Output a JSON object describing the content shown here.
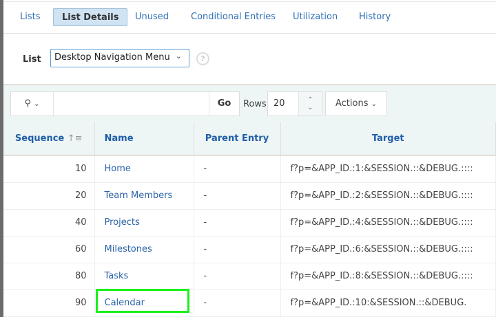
{
  "tabs": [
    {
      "label": "Lists"
    },
    {
      "label": "List Details",
      "active": true
    },
    {
      "label": "Unused"
    },
    {
      "label": "Conditional Entries"
    },
    {
      "label": "Utilization"
    },
    {
      "label": "History"
    }
  ],
  "list_field": {
    "label": "List",
    "value": "Desktop Navigation Menu",
    "help": "?"
  },
  "toolbar": {
    "search_value": "",
    "go_label": "Go",
    "rows_label": "Rows",
    "rows_value": "20",
    "actions_label": "Actions"
  },
  "columns": [
    "Sequence",
    "Name",
    "Parent Entry",
    "Target"
  ],
  "rows": [
    {
      "seq": "10",
      "name": "Home",
      "parent": "-",
      "target": "f?p=&APP_ID.:1:&SESSION.::&DEBUG.::::"
    },
    {
      "seq": "20",
      "name": "Team Members",
      "parent": "-",
      "target": "f?p=&APP_ID.:2:&SESSION.::&DEBUG.::::"
    },
    {
      "seq": "40",
      "name": "Projects",
      "parent": "-",
      "target": "f?p=&APP_ID.:4:&SESSION.::&DEBUG.::::"
    },
    {
      "seq": "60",
      "name": "Milestones",
      "parent": "-",
      "target": "f?p=&APP_ID.:6:&SESSION.::&DEBUG.::::"
    },
    {
      "seq": "80",
      "name": "Tasks",
      "parent": "-",
      "target": "f?p=&APP_ID.:8:&SESSION.::&DEBUG.::::"
    },
    {
      "seq": "90",
      "name": "Calendar",
      "parent": "-",
      "target": "f?p=&APP_ID.:10:&SESSION.::&DEBUG."
    }
  ],
  "highlight_color": "#19f019"
}
